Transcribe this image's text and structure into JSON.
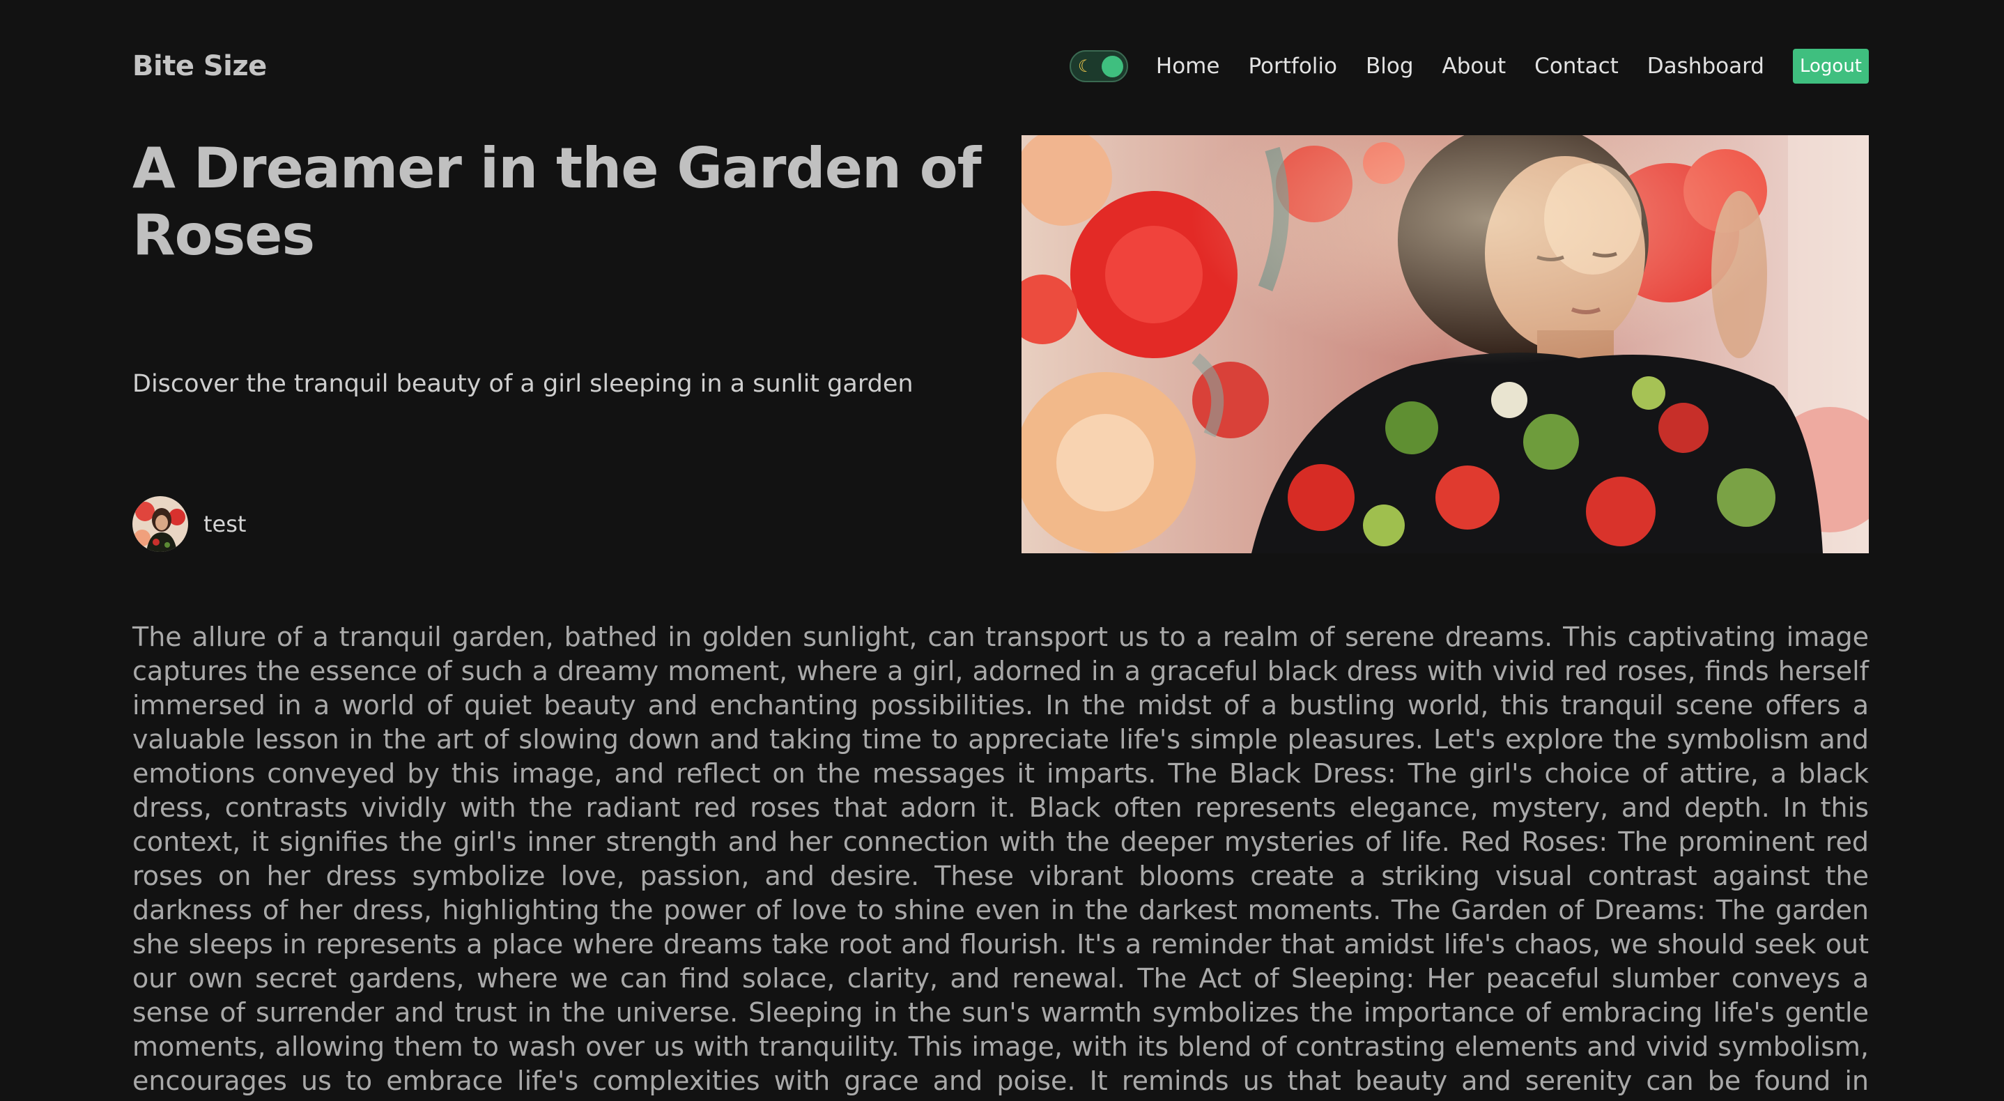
{
  "header": {
    "logo": "Bite Size",
    "theme_toggle": {
      "icon": "moon-icon",
      "state": "dark",
      "accent_color": "#3fbf7f"
    },
    "nav": [
      {
        "label": "Home"
      },
      {
        "label": "Portfolio"
      },
      {
        "label": "Blog"
      },
      {
        "label": "About"
      },
      {
        "label": "Contact"
      },
      {
        "label": "Dashboard"
      }
    ],
    "logout_label": "Logout"
  },
  "post": {
    "title": "A Dreamer in the Garden of Roses",
    "subtitle": "Discover the tranquil beauty of a girl sleeping in a sunlit garden",
    "author": {
      "name": "test"
    },
    "body": "The allure of a tranquil garden, bathed in golden sunlight, can transport us to a realm of serene dreams. This captivating image captures the essence of such a dreamy moment, where a girl, adorned in a graceful black dress with vivid red roses, finds herself immersed in a world of quiet beauty and enchanting possibilities. In the midst of a bustling world, this tranquil scene offers a valuable lesson in the art of slowing down and taking time to appreciate life's simple pleasures. Let's explore the symbolism and emotions conveyed by this image, and reflect on the messages it imparts. The Black Dress: The girl's choice of attire, a black dress, contrasts vividly with the radiant red roses that adorn it. Black often represents elegance, mystery, and depth. In this context, it signifies the girl's inner strength and her connection with the deeper mysteries of life. Red Roses: The prominent red roses on her dress symbolize love, passion, and desire. These vibrant blooms create a striking visual contrast against the darkness of her dress, highlighting the power of love to shine even in the darkest moments. The Garden of Dreams: The garden she sleeps in represents a place where dreams take root and flourish. It's a reminder that amidst life's chaos, we should seek out our own secret gardens, where we can find solace, clarity, and renewal. The Act of Sleeping: Her peaceful slumber conveys a sense of surrender and trust in the universe. Sleeping in the sun's warmth symbolizes the importance of embracing life's gentle moments, allowing them to wash over us with tranquility. This image, with its blend of contrasting elements and vivid symbolism, encourages us to embrace life's complexities with grace and poise. It reminds us that beauty and serenity can be found in unexpected places, and that we should take the time to"
  },
  "colors": {
    "background": "#121212",
    "accent": "#3fbf7f",
    "title": "#c0c0c0",
    "body_text": "#a9a9a9"
  }
}
